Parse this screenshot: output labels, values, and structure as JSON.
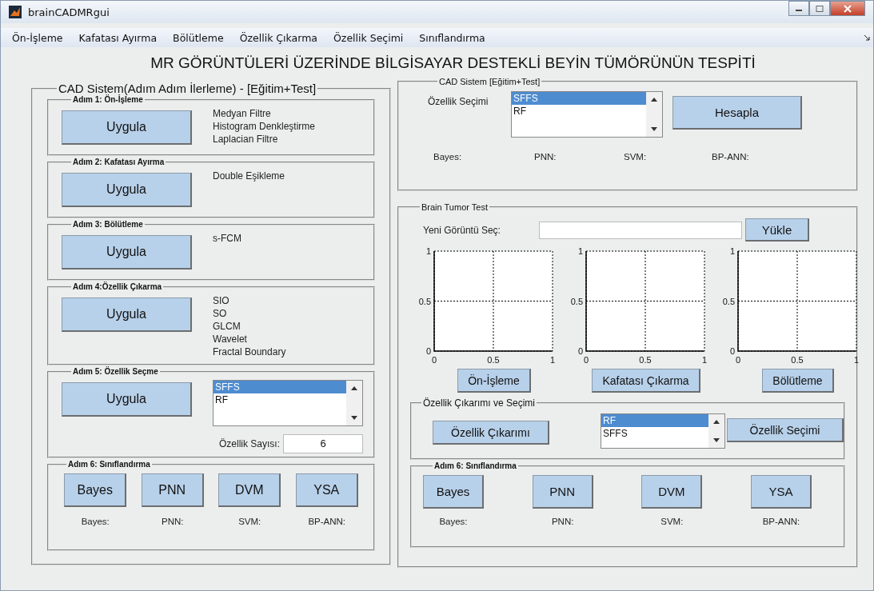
{
  "window": {
    "title": "brainCADMRgui"
  },
  "menu": [
    "Ön-İşleme",
    "Kafatası Ayırma",
    "Bölütleme",
    "Özellik Çıkarma",
    "Özellik Seçimi",
    "Sınıflandırma"
  ],
  "heading": "MR GÖRÜNTÜLERİ ÜZERİNDE BİLGİSAYAR DESTEKLİ BEYİN TÜMÖRÜNÜN TESPİTİ",
  "left_panel": {
    "title": "CAD Sistem(Adım Adım İlerleme) - [Eğitim+Test]",
    "steps": [
      {
        "kind": "apply",
        "title": "Adım 1: Ön-İşleme",
        "button": "Uygula",
        "notes": [
          "Medyan Filtre",
          "Histogram Denkleştirme",
          "Laplacian Filtre"
        ]
      },
      {
        "kind": "apply",
        "title": "Adım 2: Kafatası Ayırma",
        "button": "Uygula",
        "notes": [
          "Double Eşikleme"
        ]
      },
      {
        "kind": "apply",
        "title": "Adım 3: Bölütleme",
        "button": "Uygula",
        "notes": [
          "s-FCM"
        ]
      },
      {
        "kind": "apply",
        "title": "Adım 4:Özellik Çıkarma",
        "button": "Uygula",
        "notes": [
          "SIO",
          "SO",
          "GLCM",
          "Wavelet",
          "Fractal Boundary"
        ]
      },
      {
        "kind": "select",
        "title": "Adım 5: Özellik Seçme",
        "button": "Uygula",
        "list": [
          {
            "label": "SFFS",
            "selected": true
          },
          {
            "label": "RF",
            "selected": false
          }
        ],
        "count_label": "Özellik Sayısı:",
        "count_value": "6"
      },
      {
        "kind": "classify",
        "title": "Adım 6: Sınıflandırma",
        "buttons": [
          "Bayes",
          "PNN",
          "DVM",
          "YSA"
        ],
        "results": [
          "Bayes:",
          "PNN:",
          "SVM:",
          "BP-ANN:"
        ]
      }
    ]
  },
  "cad_panel": {
    "title": "CAD Sistem [Eğitim+Test]",
    "list_label": "Özellik Seçimi",
    "list": [
      {
        "label": "SFFS",
        "selected": true
      },
      {
        "label": "RF",
        "selected": false
      }
    ],
    "button": "Hesapla",
    "results": [
      "Bayes:",
      "PNN:",
      "SVM:",
      "BP-ANN:"
    ]
  },
  "test_panel": {
    "title": "Brain Tumor Test",
    "file_label": "Yeni Görüntü Seç:",
    "load_button": "Yükle",
    "plots": [
      {
        "button": "Ön-İşleme",
        "chart_data": {
          "type": "line",
          "xlim": [
            0,
            1
          ],
          "ylim": [
            0,
            1
          ],
          "xticks": [
            0,
            0.5,
            1
          ],
          "yticks": [
            0,
            0.5,
            1
          ]
        }
      },
      {
        "button": "Kafatası Çıkarma",
        "chart_data": {
          "type": "line",
          "xlim": [
            0,
            1
          ],
          "ylim": [
            0,
            1
          ],
          "xticks": [
            0,
            0.5,
            1
          ],
          "yticks": [
            0,
            0.5,
            1
          ]
        }
      },
      {
        "button": "Bölütleme",
        "chart_data": {
          "type": "line",
          "xlim": [
            0,
            1
          ],
          "ylim": [
            0,
            1
          ],
          "xticks": [
            0,
            0.5,
            1
          ],
          "yticks": [
            0,
            0.5,
            1
          ]
        }
      }
    ],
    "feature_group": {
      "title": "Özellik Çıkarımı ve Seçimi",
      "extract_button": "Özellik Çıkarımı",
      "list": [
        {
          "label": "RF",
          "selected": true
        },
        {
          "label": "SFFS",
          "selected": false
        }
      ],
      "select_button": "Özellik Seçimi"
    },
    "classify": {
      "title": "Adım 6: Sınıflandırma",
      "buttons": [
        "Bayes",
        "PNN",
        "DVM",
        "YSA"
      ],
      "results": [
        "Bayes:",
        "PNN:",
        "SVM:",
        "BP-ANN:"
      ]
    }
  }
}
